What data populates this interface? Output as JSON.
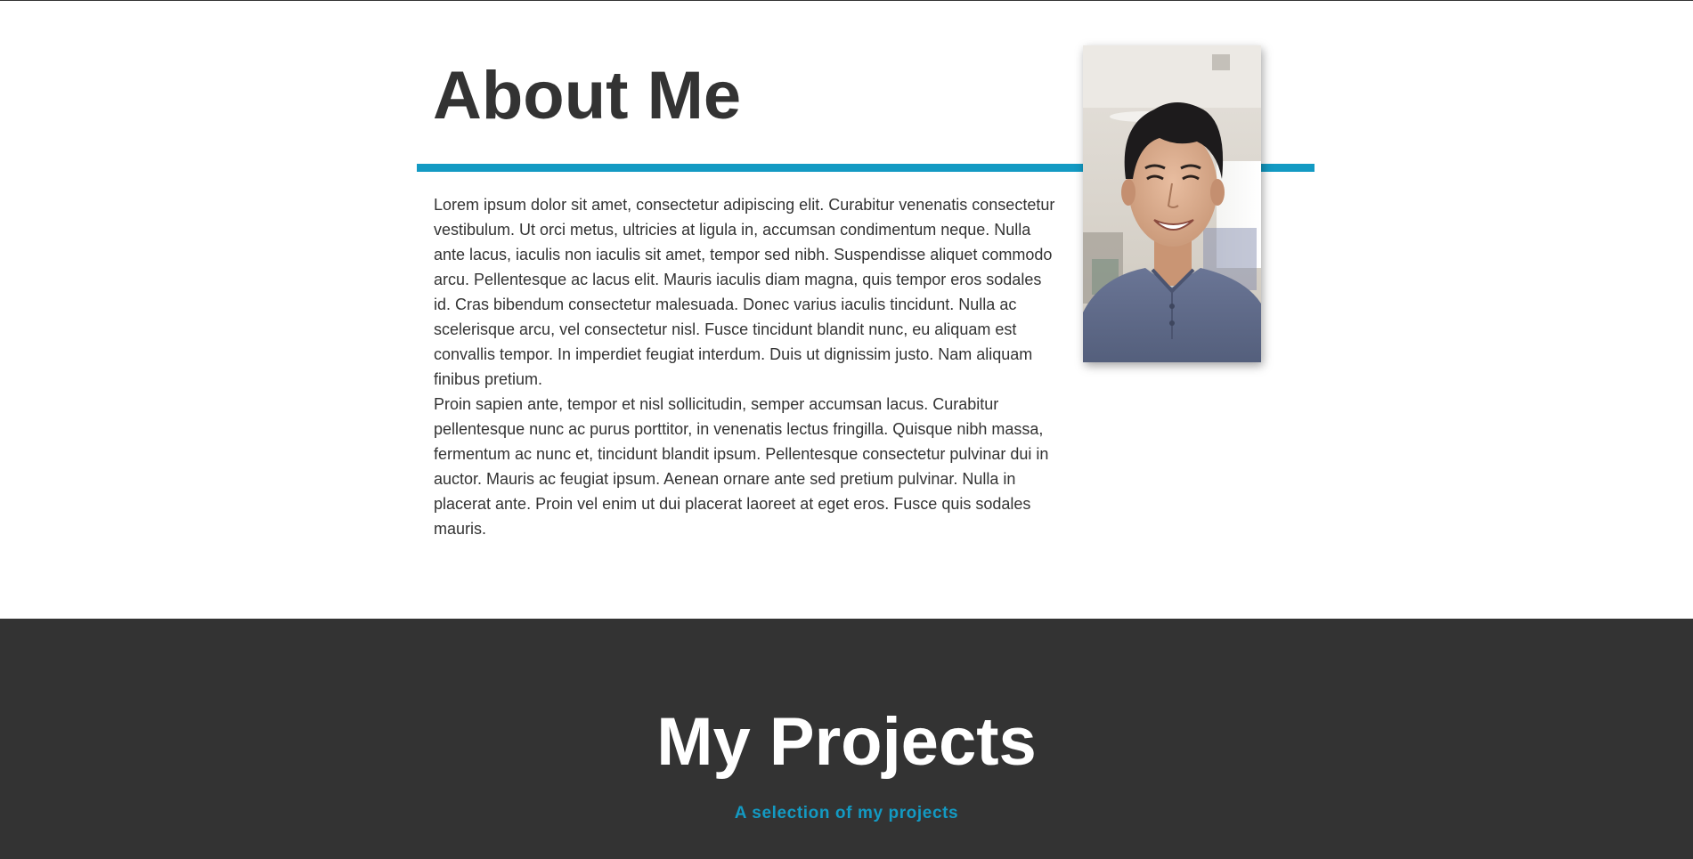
{
  "about": {
    "title": "About Me",
    "paragraphs": [
      "Lorem ipsum dolor sit amet, consectetur adipiscing elit. Curabitur venenatis consectetur vestibulum. Ut orci metus, ultricies at ligula in, accumsan condimentum neque. Nulla ante lacus, iaculis non iaculis sit amet, tempor sed nibh. Suspendisse aliquet commodo arcu. Pellentesque ac lacus elit. Mauris iaculis diam magna, quis tempor eros sodales id. Cras bibendum consectetur malesuada. Donec varius iaculis tincidunt. Nulla ac scelerisque arcu, vel consectetur nisl. Fusce tincidunt blandit nunc, eu aliquam est convallis tempor. In imperdiet feugiat interdum. Duis ut dignissim justo. Nam aliquam finibus pretium.",
      "Proin sapien ante, tempor et nisl sollicitudin, semper accumsan lacus. Curabitur pellentesque nunc ac purus porttitor, in venenatis lectus fringilla. Quisque nibh massa, fermentum ac nunc et, tincidunt blandit ipsum. Pellentesque consectetur pulvinar dui in auctor. Mauris ac feugiat ipsum. Aenean ornare ante sed pretium pulvinar. Nulla in placerat ante. Proin vel enim ut dui placerat laoreet at eget eros. Fusce quis sodales mauris."
    ]
  },
  "projects": {
    "title": "My Projects",
    "subtitle": "A selection of my projects"
  },
  "colors": {
    "accent": "#139ac3",
    "dark_background": "#333333",
    "text": "#333333",
    "light_background": "#ffffff"
  }
}
